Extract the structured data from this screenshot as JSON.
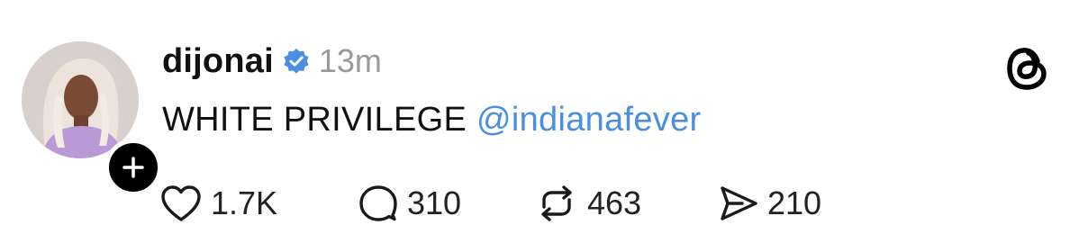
{
  "post": {
    "username": "dijonai",
    "timestamp": "13m",
    "text": "WHITE PRIVILEGE",
    "mention": "@indianafever",
    "stats": {
      "likes": "1.7K",
      "replies": "310",
      "reposts": "463",
      "shares": "210"
    }
  },
  "icons": {
    "verified": "verified-badge-icon",
    "follow": "plus-icon",
    "brand": "threads-logo-icon",
    "like": "heart-icon",
    "reply": "comment-bubble-icon",
    "repost": "repost-arrows-icon",
    "share": "send-icon"
  },
  "colors": {
    "mention": "#4a8fe0",
    "verified": "#4a8fe0",
    "timestamp": "#9a9a9a"
  }
}
